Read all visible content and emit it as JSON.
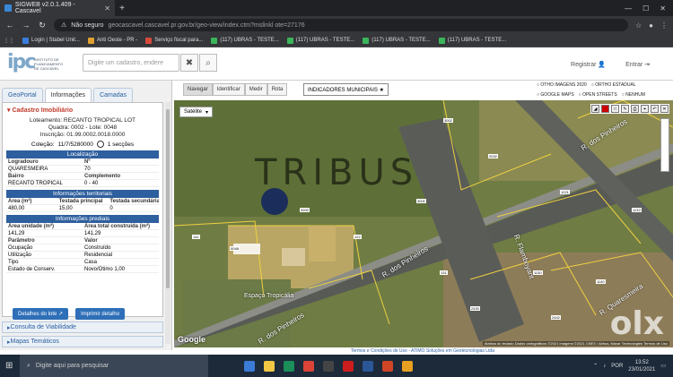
{
  "browser": {
    "tab_title": "SIGWEB v2.0.1.409 - Cascavel",
    "new_tab": "+",
    "address_warning": "Não seguro",
    "url": "geocascavel.cascavel.pr.gov.br/geo-view/index.ctm?mslinkl ote=27176",
    "bookmarks": [
      "Login | Stabel Unit...",
      "Anti Oeste - PR -",
      "Serviço fiscal para...",
      "(117) UBRAS - TESTE...",
      "(117) UBRAS - TESTE...",
      "(117) UBRAS - TESTE...",
      "(117) UBRAS - TESTE..."
    ]
  },
  "header": {
    "logo_letters": "ipc",
    "logo_text": "INSTITUTO DE PLANEJAMENTO DE CASCAVEL",
    "search_placeholder": "Digite um cadastro, endere",
    "clear_icon": "✖",
    "search_icon": "⌕",
    "register": "Registrar",
    "login": "Entrar"
  },
  "sidebar": {
    "tabs": [
      "GeoPortal",
      "Informações",
      "Camadas"
    ],
    "section_title": "Cadastro Imobiliário",
    "loteamento": "Loteamento: RECANTO TROPICAL LOT",
    "quadra_lote": "Quadra: 0002 - Lote: 0048",
    "inscricao": "Inscrição: 01.99.0002.0018.0000",
    "colecao_label": "Coleção:",
    "colecao_value": "11/7/5280000",
    "colecao_count": "1 secções",
    "localizacao": {
      "header": "Localização",
      "cols": [
        "Logradouro",
        "Nº"
      ],
      "values": [
        "QUARESMEIRA",
        "70"
      ],
      "cols2": [
        "Bairro",
        "Complemento"
      ],
      "values2": [
        "RECANTO TROPICAL",
        "0 - 40"
      ]
    },
    "territoriais": {
      "header": "Informações territoriais",
      "cols": [
        "Área (m²)",
        "Testada principal",
        "Testada secundária"
      ],
      "values": [
        "480,00",
        "15,00",
        "0"
      ]
    },
    "prediais": {
      "header": "Informações prediais",
      "cols": [
        "Área unidade (m²)",
        "Área total construída (m²)"
      ],
      "values": [
        "141,29",
        "141,29"
      ],
      "cols2": [
        "Parâmetro",
        "Valor"
      ],
      "rows": [
        [
          "Ocupação",
          "Construído"
        ],
        [
          "Utilização",
          "Residencial"
        ],
        [
          "Tipo",
          "Casa"
        ],
        [
          "Estado de Conserv.",
          "Novo/Ótimo 1,00"
        ]
      ]
    },
    "btn_details": "Detalhes do lote ↗",
    "btn_print": "Imprimir detalho",
    "acc_viability": "Consulta de Viabilidade",
    "acc_maps": "Mapas Temáticos"
  },
  "mapbar": {
    "tabs": [
      "Navegar",
      "Identificar",
      "Medir",
      "Rota"
    ],
    "indicators": "INDICADORES MUNICIPAIS ★",
    "radios": [
      "OTHO IMAGENS 2020",
      "ORTHO ESTADUAL",
      "GOOGLE MAPS",
      "OPEN STREETS",
      "NENHUM"
    ]
  },
  "map": {
    "layer_select": "Satélite",
    "watermark": "TRIBUS",
    "streets": [
      "R. dos Pinheiros",
      "R. dos Pinheiros",
      "R. Flamboyant",
      "R. Quaresmeira",
      "R. dos Pinheiros",
      "Espaço Tropicália"
    ],
    "lots": [
      "141",
      "122",
      "131",
      "2032",
      "1221",
      "1210",
      "1130",
      "1140",
      "2430",
      "2442",
      "3001",
      "3002",
      "3200",
      "0048"
    ],
    "google": "Google",
    "copyright": "Atalhos do teclado  Dados cartográficos ©2021 Imagens ©2021 CNES / Airbus, Maxar Technologies  Termos de Uso",
    "olx": "olx"
  },
  "footer": "Termos e Condições de Uso - ATIMO Soluções em Geotecnologias Ltda",
  "taskbar": {
    "search": "Digite aqui para pesquisar",
    "lang": "POR",
    "time": "13:52",
    "date": "23/01/2021"
  }
}
